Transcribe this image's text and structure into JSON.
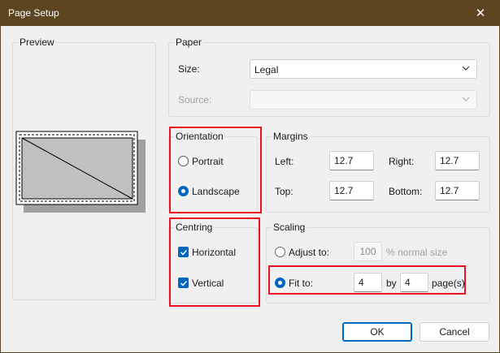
{
  "window": {
    "title": "Page Setup",
    "close_glyph": "✕"
  },
  "preview": {
    "label": "Preview"
  },
  "paper": {
    "label": "Paper",
    "size_label": "Size:",
    "size_value": "Legal",
    "source_label": "Source:",
    "source_value": ""
  },
  "orientation": {
    "label": "Orientation",
    "portrait_label": "Portrait",
    "landscape_label": "Landscape",
    "selected": "landscape"
  },
  "margins": {
    "label": "Margins",
    "left_label": "Left:",
    "left_value": "12.7",
    "right_label": "Right:",
    "right_value": "12.7",
    "top_label": "Top:",
    "top_value": "12.7",
    "bottom_label": "Bottom:",
    "bottom_value": "12.7"
  },
  "centring": {
    "label": "Centring",
    "horizontal_label": "Horizontal",
    "vertical_label": "Vertical",
    "horizontal_checked": true,
    "vertical_checked": true
  },
  "scaling": {
    "label": "Scaling",
    "adjust_label": "Adjust to:",
    "adjust_value": "100",
    "adjust_suffix": "% normal size",
    "fit_label": "Fit to:",
    "fit_wide": "4",
    "by_label": "by",
    "fit_tall": "4",
    "pages_label": "page(s)",
    "selected": "fit"
  },
  "buttons": {
    "ok_label": "OK",
    "cancel_label": "Cancel"
  },
  "colors": {
    "accent": "#0067c0",
    "titlebar": "#5c4520",
    "highlight": "#e81123"
  }
}
